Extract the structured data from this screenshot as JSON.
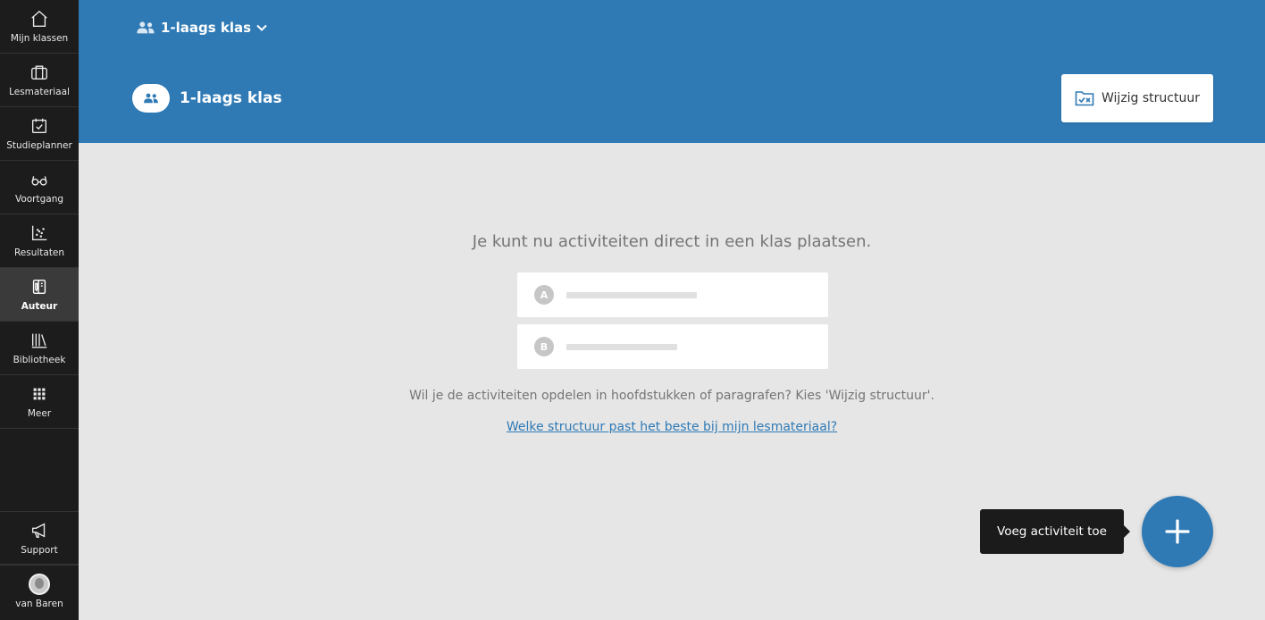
{
  "sidebar": {
    "items": [
      {
        "label": "Mijn klassen",
        "icon": "home-icon"
      },
      {
        "label": "Lesmateriaal",
        "icon": "briefcase-icon"
      },
      {
        "label": "Studieplanner",
        "icon": "calendar-check-icon"
      },
      {
        "label": "Voortgang",
        "icon": "glasses-icon"
      },
      {
        "label": "Resultaten",
        "icon": "scatter-chart-icon"
      },
      {
        "label": "Auteur",
        "icon": "author-book-icon",
        "active": true
      },
      {
        "label": "Bibliotheek",
        "icon": "library-icon"
      },
      {
        "label": "Meer",
        "icon": "grid-icon"
      }
    ],
    "support_label": "Support",
    "user_label": "van Baren"
  },
  "header": {
    "class_switcher_label": "1-laags klas",
    "class_title": "1-laags klas",
    "wijzig_label": "Wijzig structuur"
  },
  "main": {
    "headline": "Je kunt nu activiteiten direct in een klas plaatsen.",
    "placeholder_a": "A",
    "placeholder_b": "B",
    "subtext": "Wil je de activiteiten opdelen in hoofdstukken of paragrafen? Kies 'Wijzig structuur'.",
    "help_link": "Welke structuur past het beste bij mijn lesmateriaal?"
  },
  "fab": {
    "tooltip": "Voeg activiteit toe"
  },
  "colors": {
    "accent": "#2f7ab5",
    "sidebar_bg": "#1c1c1c",
    "main_bg": "#e6e6e6"
  }
}
